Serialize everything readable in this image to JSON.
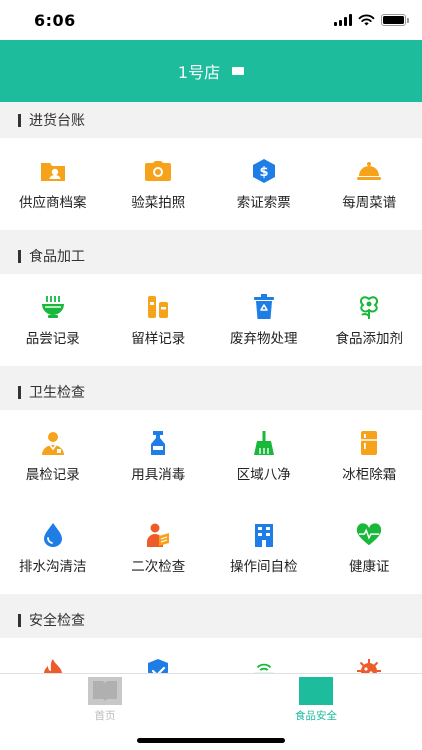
{
  "status_bar": {
    "time": "6:06"
  },
  "header": {
    "title": "1号店"
  },
  "sections": [
    {
      "title": "进货台账",
      "items": [
        {
          "label": "供应商档案",
          "icon": "supplier-folder-icon"
        },
        {
          "label": "验菜拍照",
          "icon": "camera-icon"
        },
        {
          "label": "索证索票",
          "icon": "invoice-dollar-icon"
        },
        {
          "label": "每周菜谱",
          "icon": "dish-cover-icon"
        }
      ]
    },
    {
      "title": "食品加工",
      "items": [
        {
          "label": "品尝记录",
          "icon": "bowl-icon"
        },
        {
          "label": "留样记录",
          "icon": "sample-jar-icon"
        },
        {
          "label": "废弃物处理",
          "icon": "recycle-bin-icon"
        },
        {
          "label": "食品添加剂",
          "icon": "additive-plant-icon"
        }
      ]
    },
    {
      "title": "卫生检查",
      "items": [
        {
          "label": "晨检记录",
          "icon": "health-worker-icon"
        },
        {
          "label": "用具消毒",
          "icon": "spray-bottle-icon"
        },
        {
          "label": "区域八净",
          "icon": "broom-icon"
        },
        {
          "label": "冰柜除霜",
          "icon": "fridge-icon"
        },
        {
          "label": "排水沟清洁",
          "icon": "water-drop-icon"
        },
        {
          "label": "二次检查",
          "icon": "reading-person-icon"
        },
        {
          "label": "操作间自检",
          "icon": "building-icon"
        },
        {
          "label": "健康证",
          "icon": "heart-pulse-icon"
        }
      ]
    },
    {
      "title": "安全检查",
      "items": [
        {
          "label": "",
          "icon": "fire-icon"
        },
        {
          "label": "",
          "icon": "shield-check-icon"
        },
        {
          "label": "",
          "icon": "router-icon"
        },
        {
          "label": "",
          "icon": "virus-icon"
        }
      ]
    }
  ],
  "tabbar": {
    "tabs": [
      {
        "label": "首页",
        "icon": "home-icon",
        "active": false
      },
      {
        "label": "食品安全",
        "icon": "food-safety-icon",
        "active": true
      }
    ]
  },
  "colors": {
    "primary": "#1dbc9c",
    "inactive_tab": "#bbbbbb",
    "orange": "#f7a21b",
    "blue": "#1e7ee6",
    "green": "#1ab83a",
    "red": "#ee5a2a"
  }
}
